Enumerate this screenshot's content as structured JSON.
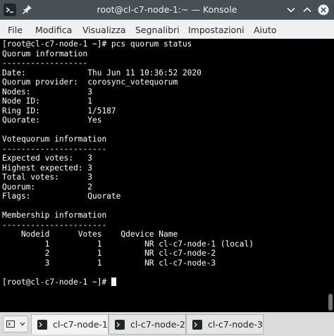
{
  "window": {
    "title": "root@cl-c7-node-1:~ — Konsole"
  },
  "menubar": {
    "items": [
      "File",
      "Modifica",
      "Visualizza",
      "Segnalibri",
      "Impostazioni",
      "Aiuto"
    ]
  },
  "terminal": {
    "lines": [
      "[root@cl-c7-node-1 ~]# pcs quorum status",
      "Quorum information",
      "------------------",
      "Date:             Thu Jun 11 10:36:52 2020",
      "Quorum provider:  corosync_votequorum",
      "Nodes:            3",
      "Node ID:          1",
      "Ring ID:          1/5187",
      "Quorate:          Yes",
      "",
      "Votequorum information",
      "----------------------",
      "Expected votes:   3",
      "Highest expected: 3",
      "Total votes:      3",
      "Quorum:           2",
      "Flags:            Quorate",
      "",
      "Membership information",
      "----------------------",
      "    Nodeid      Votes    Qdevice Name",
      "         1          1         NR cl-c7-node-1 (local)",
      "         2          1         NR cl-c7-node-2",
      "         3          1         NR cl-c7-node-3",
      "",
      "[root@cl-c7-node-1 ~]# "
    ]
  },
  "tabs": [
    {
      "label": "cl-c7-node-1",
      "active": true
    },
    {
      "label": "cl-c7-node-2",
      "active": false
    },
    {
      "label": "cl-c7-node-3",
      "active": false
    }
  ],
  "icons": {
    "app": "konsole-icon",
    "pin": "pin-icon",
    "minimize": "chevron-down-icon",
    "maximize": "chevron-up-icon",
    "close": "close-icon",
    "new_tab": "new-tab-icon",
    "tab": "terminal-icon"
  },
  "colors": {
    "titlebar": "#475057",
    "terminal_bg": "#000000",
    "terminal_fg": "#ffffff",
    "menubar": "#eff0f1"
  }
}
